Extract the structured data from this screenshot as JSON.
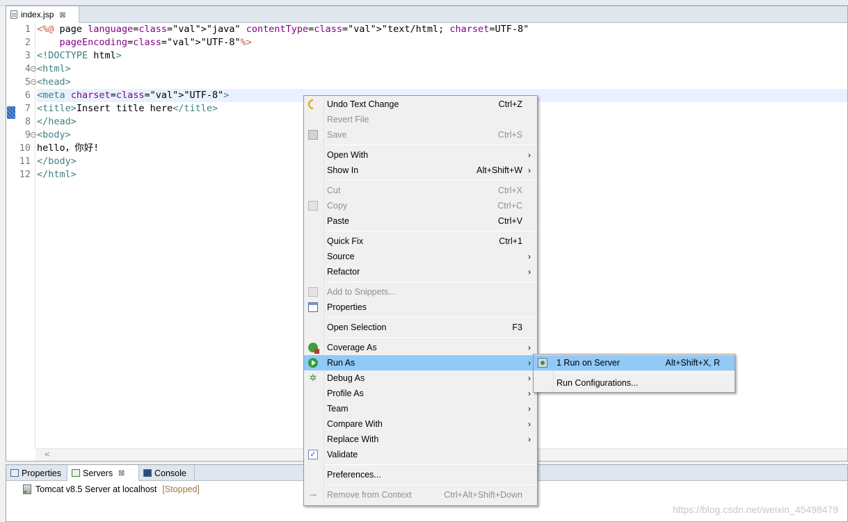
{
  "editor": {
    "tab_title": "index.jsp",
    "tab_close": "⊠",
    "line_numbers": [
      "1",
      "2",
      "3",
      "4",
      "5",
      "6",
      "7",
      "8",
      "9",
      "10",
      "11",
      "12"
    ],
    "code_lines": [
      "<%@ page language=\"java\" contentType=\"text/html; charset=UTF-8\"",
      "    pageEncoding=\"UTF-8\"%>",
      "<!DOCTYPE html>",
      "<html>",
      "<head>",
      "<meta charset=\"UTF-8\">",
      "<title>Insert title here</title>",
      "</head>",
      "<body>",
      "hello，你好!",
      "</body>",
      "</html>"
    ],
    "scroll_left": "<"
  },
  "context_menu": {
    "items": [
      {
        "label": "Undo Text Change",
        "shortcut": "Ctrl+Z",
        "icon": "undo-icon"
      },
      {
        "label": "Revert File",
        "disabled": true
      },
      {
        "label": "Save",
        "shortcut": "Ctrl+S",
        "disabled": true,
        "icon": "save-icon"
      },
      {
        "label": "Open With",
        "submenu": true
      },
      {
        "label": "Show In",
        "shortcut": "Alt+Shift+W",
        "submenu": true
      },
      {
        "label": "Cut",
        "shortcut": "Ctrl+X",
        "disabled": true
      },
      {
        "label": "Copy",
        "shortcut": "Ctrl+C",
        "disabled": true,
        "icon": "copy-icon"
      },
      {
        "label": "Paste",
        "shortcut": "Ctrl+V"
      },
      {
        "label": "Quick Fix",
        "shortcut": "Ctrl+1"
      },
      {
        "label": "Source",
        "submenu": true
      },
      {
        "label": "Refactor",
        "submenu": true
      },
      {
        "label": "Add to Snippets...",
        "disabled": true,
        "icon": "snippets-icon"
      },
      {
        "label": "Properties",
        "icon": "properties-icon"
      },
      {
        "label": "Open Selection",
        "shortcut": "F3"
      },
      {
        "label": "Coverage As",
        "submenu": true,
        "icon": "coverage-icon"
      },
      {
        "label": "Run As",
        "submenu": true,
        "icon": "run-icon",
        "highlighted": true
      },
      {
        "label": "Debug As",
        "submenu": true,
        "icon": "debug-icon"
      },
      {
        "label": "Profile As",
        "submenu": true
      },
      {
        "label": "Team",
        "submenu": true
      },
      {
        "label": "Compare With",
        "submenu": true
      },
      {
        "label": "Replace With",
        "submenu": true
      },
      {
        "label": "Validate",
        "icon": "checkbox-icon"
      },
      {
        "label": "Preferences..."
      },
      {
        "label": "Remove from Context",
        "shortcut": "Ctrl+Alt+Shift+Down",
        "disabled": true,
        "icon": "remove-context-icon"
      }
    ],
    "arrow": "›"
  },
  "run_as_submenu": {
    "items": [
      {
        "label": "1 Run on Server",
        "shortcut": "Alt+Shift+X, R",
        "icon": "run-on-server-icon",
        "highlighted": true
      },
      {
        "label": "Run Configurations..."
      }
    ]
  },
  "views": {
    "tabs": [
      {
        "label": "Properties",
        "icon": "properties-icon"
      },
      {
        "label": "Servers",
        "icon": "servers-icon",
        "active": true,
        "close": "⊠"
      },
      {
        "label": "Console",
        "icon": "console-icon"
      }
    ],
    "server_name": "Tomcat v8.5 Server at localhost",
    "server_status": "[Stopped]"
  },
  "watermark": "https://blog.csdn.net/weixin_45498479",
  "colors": {
    "selection_highlight": "#91c9f7",
    "current_line": "#e8f2fe",
    "tag": "#3f7f7f",
    "attribute": "#7f007f",
    "value": "#2a00ff",
    "jsp_delimiter": "#bf5f3f"
  }
}
